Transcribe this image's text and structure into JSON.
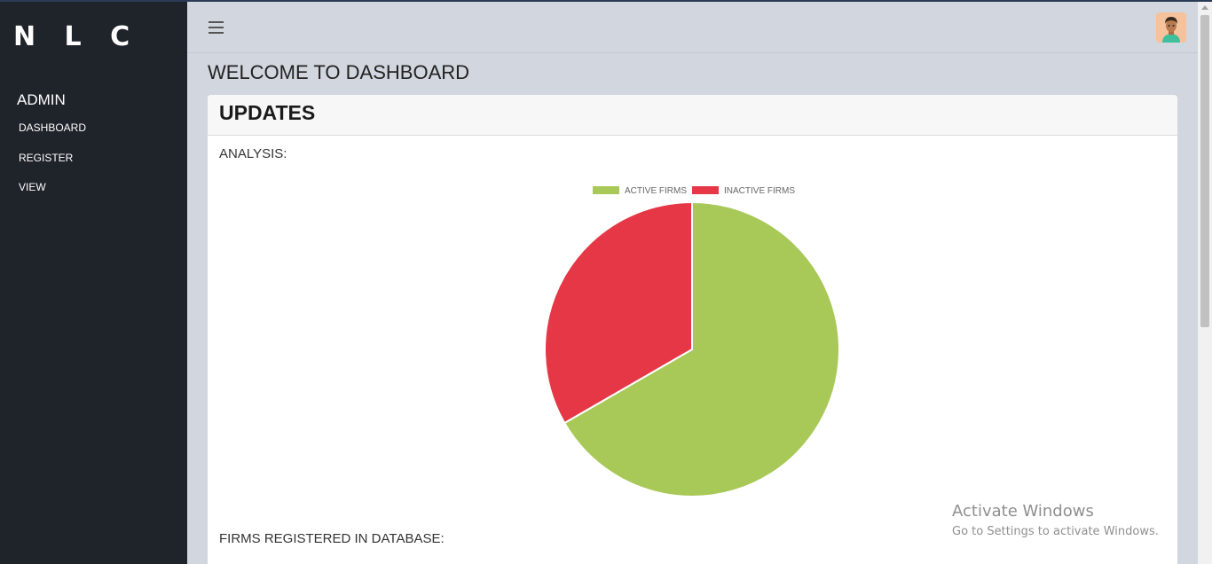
{
  "sidebar": {
    "brand": "N L C",
    "role": "ADMIN",
    "items": [
      {
        "label": "DASHBOARD"
      },
      {
        "label": "REGISTER"
      },
      {
        "label": "VIEW"
      }
    ]
  },
  "header": {
    "menu_icon": "hamburger-icon",
    "avatar_icon": "user-avatar"
  },
  "main": {
    "title": "WELCOME TO DASHBOARD",
    "card": {
      "title": "UPDATES",
      "analysis_label": "ANALYSIS:",
      "firms_label": "FIRMS REGISTERED IN DATABASE:"
    }
  },
  "chart_data": {
    "type": "pie",
    "categories": [
      "ACTIVE FIRMS",
      "INACTIVE FIRMS"
    ],
    "values": [
      2,
      1
    ],
    "colors": [
      "#a8c957",
      "#e63746"
    ],
    "legend": "top"
  },
  "watermark": {
    "line1": "Activate Windows",
    "line2": "Go to Settings to activate Windows."
  },
  "colors": {
    "sidebar": "#1f232a",
    "background": "#d2d6de"
  }
}
